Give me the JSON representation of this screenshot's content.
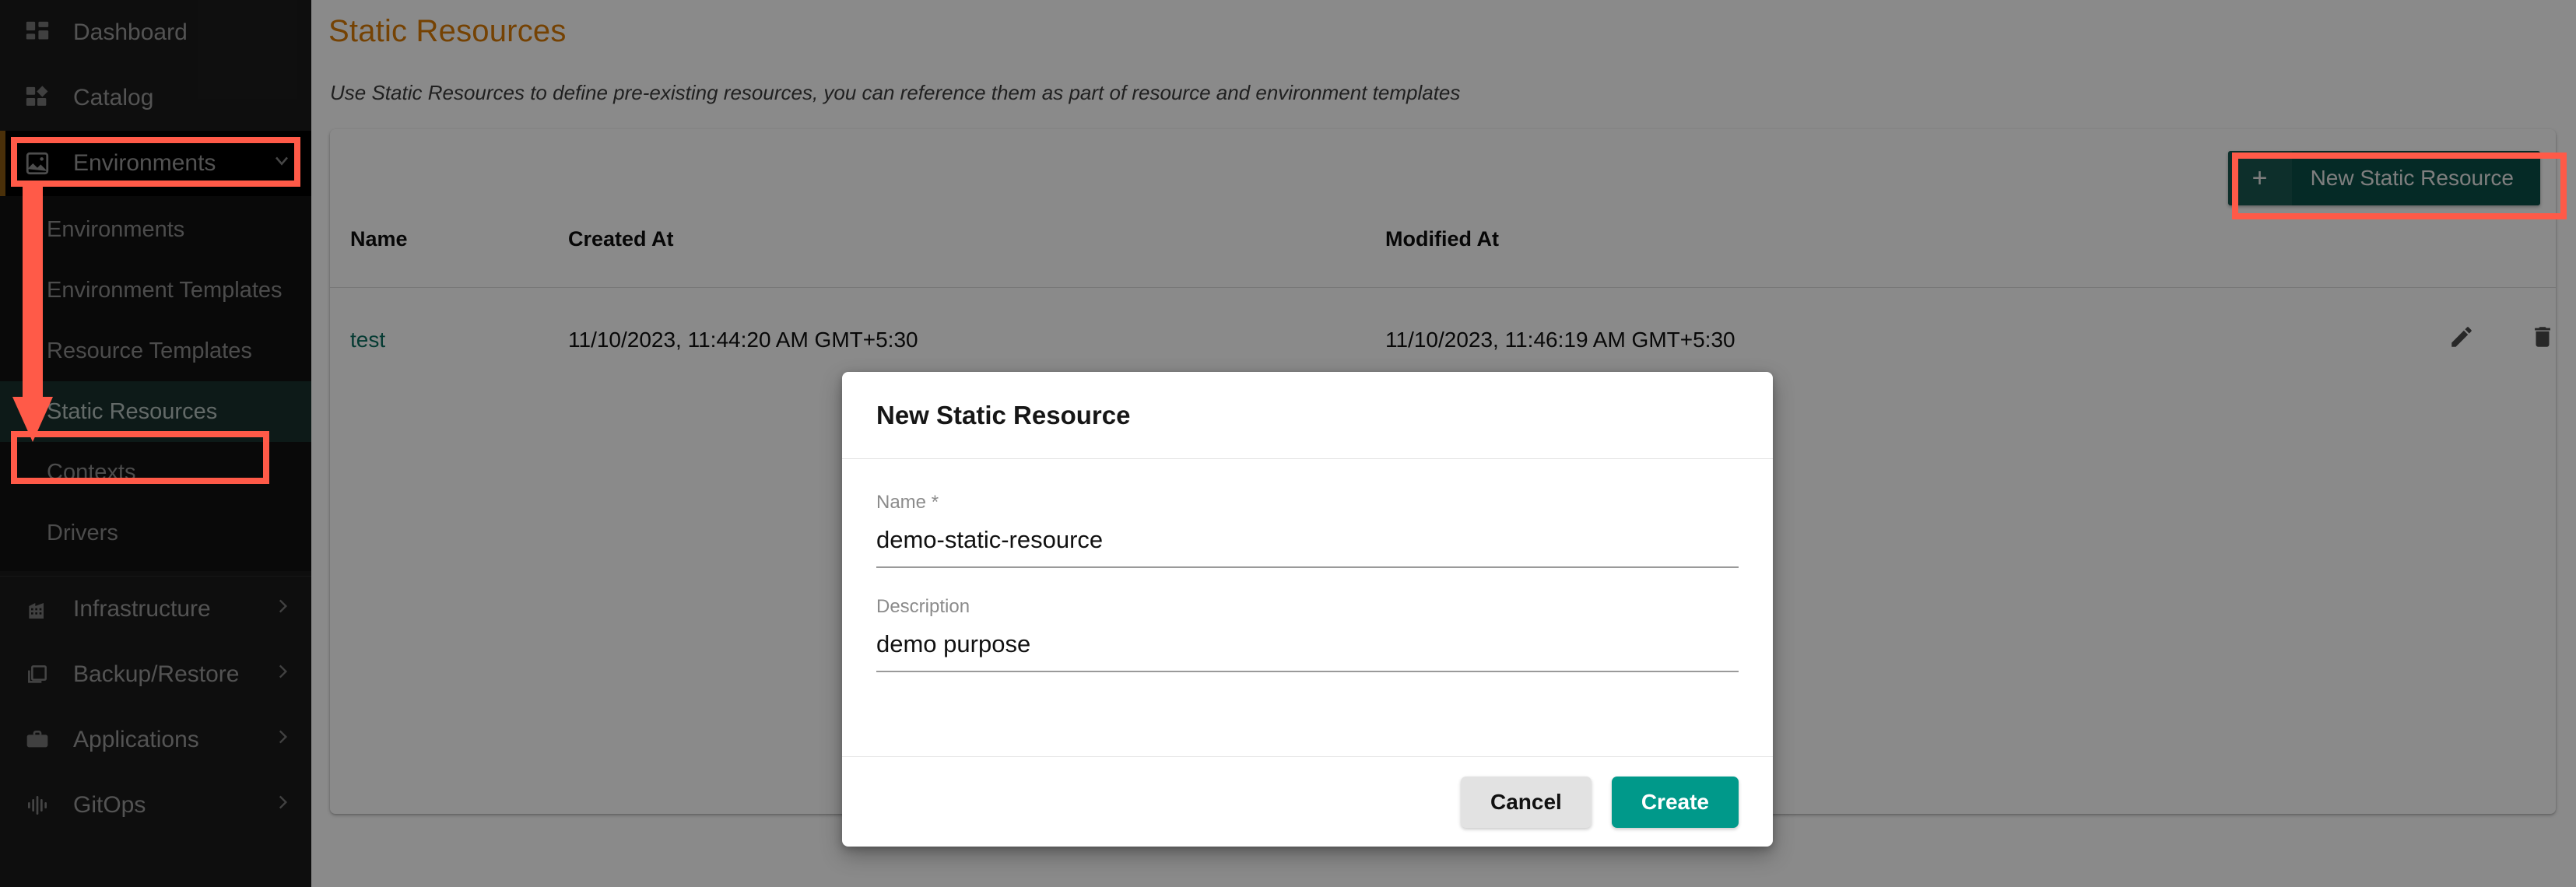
{
  "sidebar": {
    "top_items": [
      {
        "label": "Dashboard",
        "icon": "dashboard-grid-icon",
        "id": "dashboard"
      },
      {
        "label": "Catalog",
        "icon": "catalog-grid-icon",
        "id": "catalog"
      }
    ],
    "expanded_group": {
      "label": "Environments",
      "icon": "image-environments-icon",
      "chevron": "chevron-down-icon",
      "accent_color": "#8a5a12",
      "sub_items": [
        {
          "label": "Environments",
          "active": false
        },
        {
          "label": "Environment Templates",
          "active": false
        },
        {
          "label": "Resource Templates",
          "active": false
        },
        {
          "label": "Static Resources",
          "active": true
        },
        {
          "label": "Contexts",
          "active": false
        },
        {
          "label": "Drivers",
          "active": false
        }
      ],
      "active_bg": "#19312d"
    },
    "bottom_items": [
      {
        "label": "Infrastructure",
        "icon": "building-icon",
        "chevron": "chevron-right-icon"
      },
      {
        "label": "Backup/Restore",
        "icon": "copy-layers-icon",
        "chevron": "chevron-right-icon"
      },
      {
        "label": "Applications",
        "icon": "briefcase-icon",
        "chevron": "chevron-right-icon"
      },
      {
        "label": "GitOps",
        "icon": "waveform-icon",
        "chevron": "chevron-right-icon"
      }
    ]
  },
  "page": {
    "title": "Static Resources",
    "title_color": "#d97b06",
    "subtitle": "Use Static Resources to define pre-existing resources, you can reference them as part of resource and environment templates"
  },
  "toolbar": {
    "new_button_label": "New Static Resource",
    "new_button_plus": "+",
    "new_button_color": "#0b4f47"
  },
  "table": {
    "headers": {
      "name": "Name",
      "created_at": "Created At",
      "modified_at": "Modified At",
      "actions": ""
    },
    "rows": [
      {
        "name": "test",
        "created_at": "11/10/2023, 11:44:20 AM GMT+5:30",
        "modified_at": "11/10/2023, 11:46:19 AM GMT+5:30",
        "edit_icon": "pencil-icon",
        "delete_icon": "trash-icon"
      }
    ]
  },
  "modal": {
    "title": "New Static Resource",
    "fields": [
      {
        "label": "Name *",
        "value": "demo-static-resource",
        "placeholder": ""
      },
      {
        "label": "Description",
        "value": "demo purpose",
        "placeholder": ""
      }
    ],
    "cancel_label": "Cancel",
    "create_label": "Create",
    "create_color": "#00998a"
  },
  "annotations": {
    "highlight_color": "#ff5a48",
    "boxes": [
      "environments-nav-item",
      "static-resources-nav-item",
      "new-static-resource-button"
    ],
    "arrow": "down-arrow-from-environments-to-static-resources"
  }
}
